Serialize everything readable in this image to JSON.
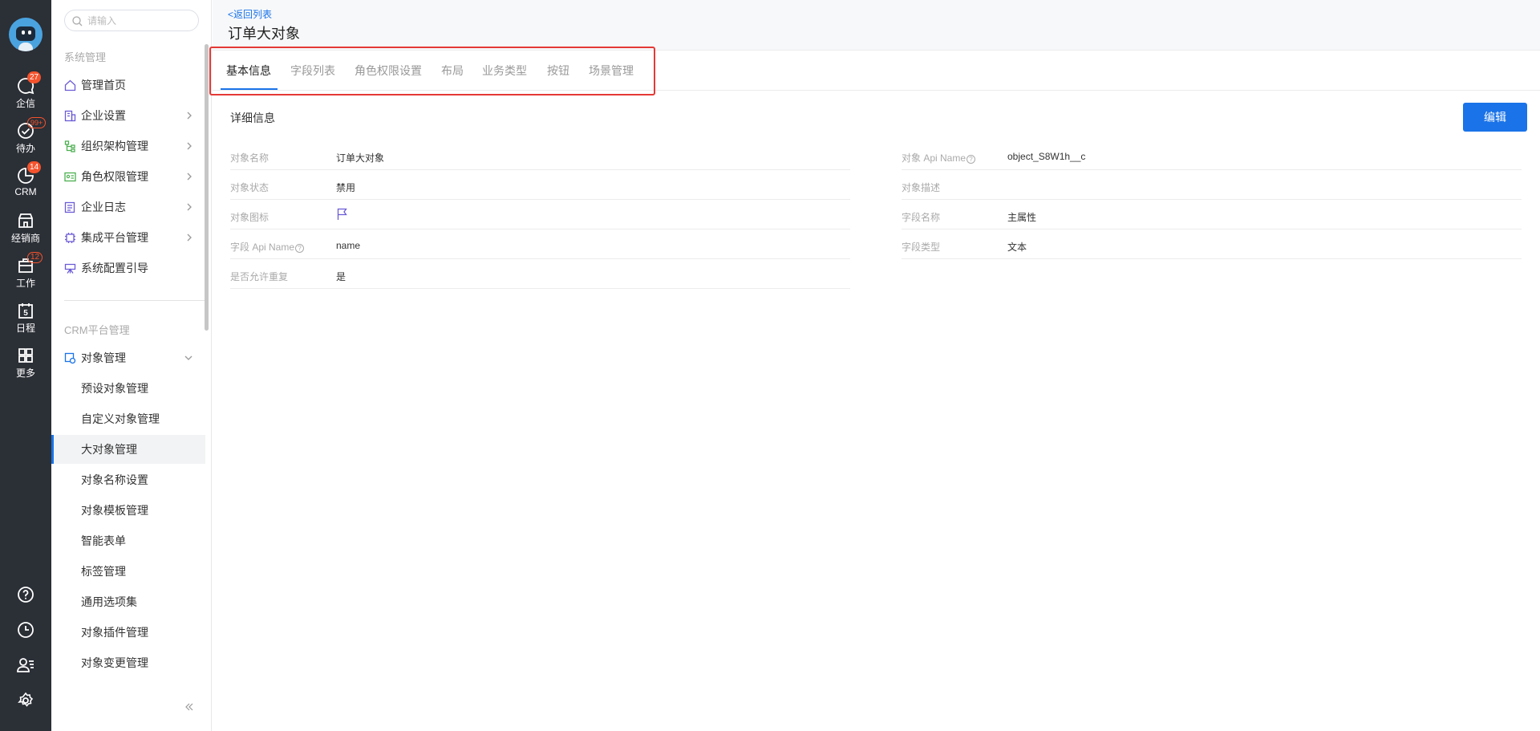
{
  "rail": {
    "items": [
      {
        "label": "企信",
        "badge": "27"
      },
      {
        "label": "待办",
        "badge": "99+"
      },
      {
        "label": "CRM",
        "badge": "14"
      },
      {
        "label": "经销商",
        "badge": ""
      },
      {
        "label": "工作",
        "badge": "12"
      },
      {
        "label": "日程",
        "badge": ""
      },
      {
        "label": "更多",
        "badge": ""
      }
    ],
    "calendar_day": "5"
  },
  "sidebar": {
    "search_placeholder": "请输入",
    "section1": "系统管理",
    "menu": [
      {
        "label": "管理首页",
        "icon": "home-icon"
      },
      {
        "label": "企业设置",
        "icon": "building-icon"
      },
      {
        "label": "组织架构管理",
        "icon": "org-chart-icon"
      },
      {
        "label": "角色权限管理",
        "icon": "id-card-icon"
      },
      {
        "label": "企业日志",
        "icon": "log-icon"
      },
      {
        "label": "集成平台管理",
        "icon": "chip-icon"
      },
      {
        "label": "系统配置引导",
        "icon": "guide-icon"
      }
    ],
    "section2": "CRM平台管理",
    "object_mgmt": "对象管理",
    "sub_items": [
      "预设对象管理",
      "自定义对象管理",
      "大对象管理",
      "对象名称设置",
      "对象模板管理",
      "智能表单",
      "标签管理",
      "通用选项集",
      "对象插件管理",
      "对象变更管理"
    ]
  },
  "header": {
    "back": "<返回列表",
    "title": "订单大对象"
  },
  "tabs": [
    "基本信息",
    "字段列表",
    "角色权限设置",
    "布局",
    "业务类型",
    "按钮",
    "场景管理"
  ],
  "detail": {
    "title": "详细信息",
    "edit": "编辑",
    "left": [
      {
        "label": "对象名称",
        "value": "订单大对象"
      },
      {
        "label": "对象状态",
        "value": "禁用"
      },
      {
        "label": "对象图标",
        "value": ""
      },
      {
        "label": "字段 Api Name",
        "value": "name"
      },
      {
        "label": "是否允许重复",
        "value": "是"
      }
    ],
    "right": [
      {
        "label": "对象 Api Name",
        "value": "object_S8W1h__c"
      },
      {
        "label": "对象描述",
        "value": ""
      },
      {
        "label": "字段名称",
        "value": "主属性"
      },
      {
        "label": "字段类型",
        "value": "文本"
      }
    ]
  },
  "colors": {
    "accent": "#1a73e8",
    "rail_bg": "#2b2f36",
    "badge": "#f5532d",
    "highlight": "#e53935"
  }
}
